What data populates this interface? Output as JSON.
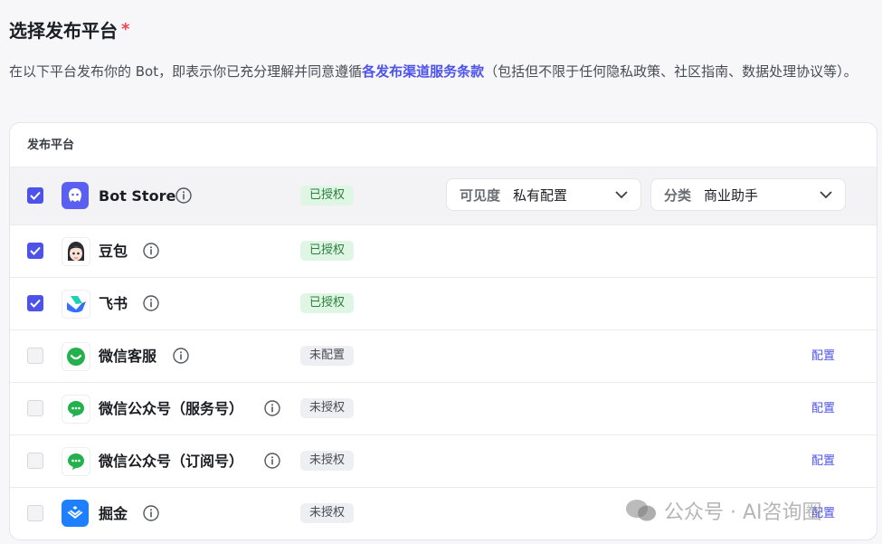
{
  "section": {
    "title": "选择发布平台",
    "required_mark": "*",
    "description_pre": "在以下平台发布你的 Bot，即表示你已充分理解并同意遵循",
    "description_link": "各发布渠道服务条款",
    "description_post": "（包括但不限于任何隐私政策、社区指南、数据处理协议等）。"
  },
  "table": {
    "header": "发布平台",
    "rows": [
      {
        "name": "Bot Store",
        "status": "已授权",
        "checked": true,
        "icon": "bot-store-icon"
      },
      {
        "name": "豆包",
        "status": "已授权",
        "checked": true,
        "icon": "doubao-avatar-icon"
      },
      {
        "name": "飞书",
        "status": "已授权",
        "checked": true,
        "icon": "feishu-icon"
      },
      {
        "name": "微信客服",
        "status": "未配置",
        "checked": false,
        "icon": "wechat-service-icon",
        "action": "配置"
      },
      {
        "name": "微信公众号（服务号）",
        "status": "未授权",
        "checked": false,
        "icon": "wechat-official-icon",
        "action": "配置"
      },
      {
        "name": "微信公众号（订阅号）",
        "status": "未授权",
        "checked": false,
        "icon": "wechat-official-icon",
        "action": "配置"
      },
      {
        "name": "掘金",
        "status": "未授权",
        "checked": false,
        "icon": "juejin-icon",
        "action": "配置"
      }
    ]
  },
  "bot_store": {
    "visibility_label": "可见度",
    "visibility_value": "私有配置",
    "category_label": "分类",
    "category_value": "商业助手"
  },
  "watermark": "公众号 · AI咨询圈",
  "colors": {
    "accent": "#4d53e8",
    "authorized_bg": "#dff6e4",
    "authorized_text": "#2b7f3d",
    "required": "#f0444b"
  }
}
